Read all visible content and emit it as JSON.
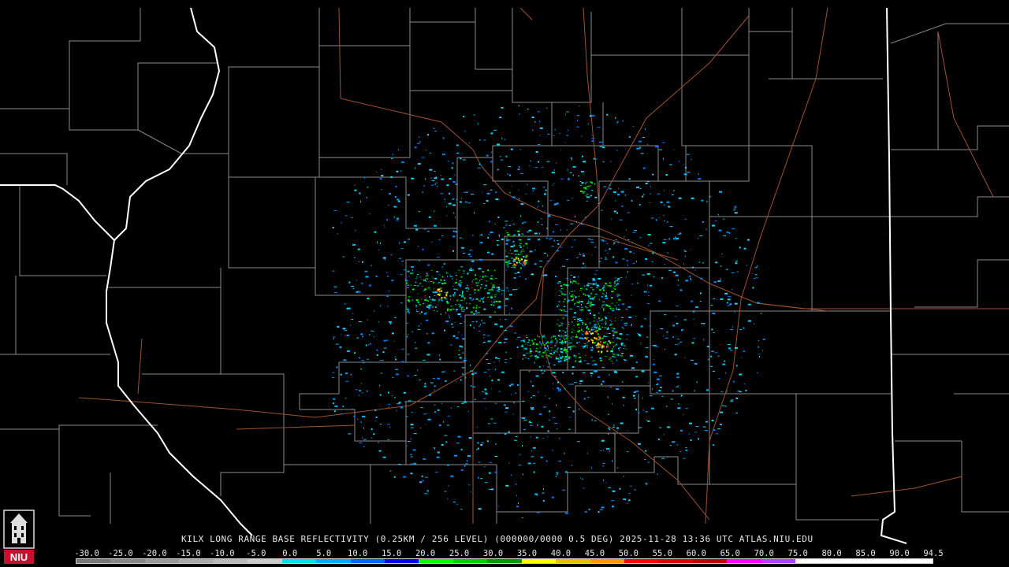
{
  "radar": {
    "caption": "KILX LONG RANGE BASE REFLECTIVITY (0.25KM / 256 LEVEL) (000000/0000 0.5 DEG) 2025-11-28 13:36 UTC  ATLAS.NIU.EDU",
    "station": "KILX",
    "product": "LONG RANGE BASE REFLECTIVITY",
    "datetime": "2025-11-28 13:36 UTC",
    "source": "ATLAS.NIU.EDU"
  },
  "scale": {
    "ticks": [
      "-30.0",
      "-25.0",
      "-20.0",
      "-15.0",
      "-10.0",
      "-5.0",
      "0.0",
      "5.0",
      "10.0",
      "15.0",
      "20.0",
      "25.0",
      "30.0",
      "35.0",
      "40.0",
      "45.0",
      "50.0",
      "55.0",
      "60.0",
      "65.0",
      "70.0",
      "75.0",
      "80.0",
      "85.0",
      "90.0",
      "94.5"
    ],
    "colors": [
      "#777777",
      "#888888",
      "#999999",
      "#aaaaaa",
      "#bbbbbb",
      "#cccccc",
      "#00ddee",
      "#00aaff",
      "#0066ff",
      "#0000ee",
      "#00ff00",
      "#00cc00",
      "#009900",
      "#ffff00",
      "#e6c000",
      "#ff9900",
      "#ff0000",
      "#dd0000",
      "#bb0000",
      "#ff00ff",
      "#aa44ff",
      "#ffffff",
      "#ffffff",
      "#ffffff",
      "#ffffff"
    ]
  },
  "logo": {
    "text": "NIU",
    "color": "#c8102e"
  },
  "map_colors": {
    "county": "#8a8a8a",
    "state": "#ffffff",
    "highway": "#a0522d",
    "background": "#000000"
  }
}
